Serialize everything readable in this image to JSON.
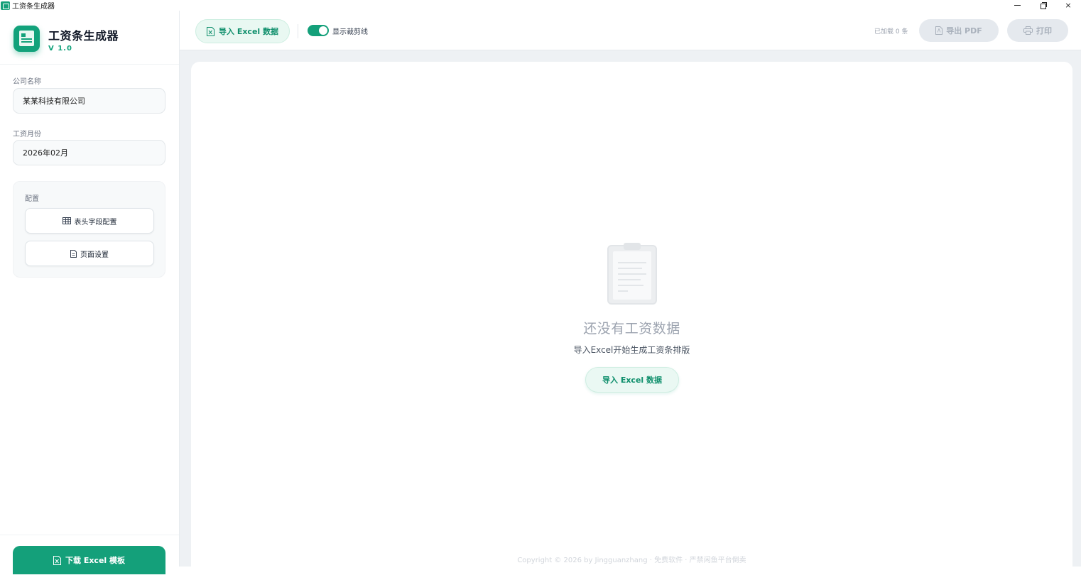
{
  "window": {
    "title": "工资条生成器",
    "controls": {
      "minimize": "minimize",
      "restore": "restore",
      "close": "×"
    }
  },
  "brand": {
    "name": "工资条生成器",
    "version": "V 1.0"
  },
  "sidebar": {
    "company_label": "公司名称",
    "company_value": "某某科技有限公司",
    "month_label": "工资月份",
    "month_value": "2026年02月",
    "config_title": "配置",
    "header_config_label": "表头字段配置",
    "page_settings_label": "页面设置",
    "download_label": "下载 Excel 模板"
  },
  "toolbar": {
    "import_label": "导入 Excel 数据",
    "toggle_label": "显示裁剪线",
    "toggle_on": true,
    "loaded_count": "已加载 0 条",
    "export_label": "导出 PDF",
    "print_label": "打印"
  },
  "main": {
    "empty_title": "还没有工资数据",
    "empty_subtitle": "导入Excel开始生成工资条排版",
    "empty_import_label": "导入 Excel 数据",
    "copyright": "Copyright © 2026 by Jingguanzhang · 免费软件 · 严禁闲鱼平台倒卖"
  },
  "colors": {
    "accent": "#14a07a",
    "accent_soft": "#e9f8f2",
    "disabled_bg": "#e5e9ee",
    "disabled_text": "#a8b0bb",
    "main_bg": "#eef1f4"
  },
  "icons": {
    "app": "app-icon",
    "excel": "excel-file-icon",
    "table": "table-icon",
    "page": "page-icon",
    "pdf": "pdf-icon",
    "print": "printer-icon",
    "empty": "clipboard-icon"
  }
}
